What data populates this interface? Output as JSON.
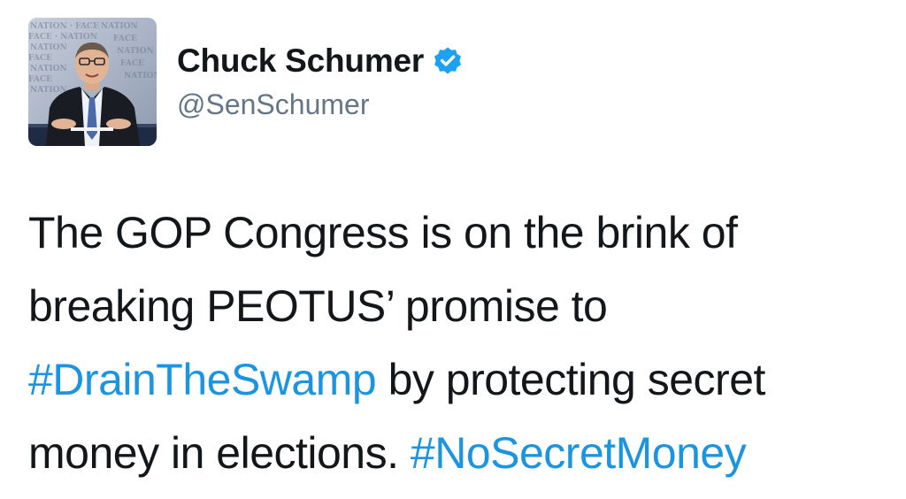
{
  "user": {
    "display_name": "Chuck Schumer",
    "handle": "@SenSchumer",
    "verified_icon": "verified-badge-icon",
    "avatar_backdrop_text": "FACE the NATION"
  },
  "tweet": {
    "line1": "The GOP Congress is on the brink of",
    "line2": "breaking PEOTUS’ promise to",
    "line3_hashtag": "#DrainTheSwamp",
    "line3_rest": " by protecting secret",
    "line4_text": "money in elections. ",
    "line4_hashtag": "#NoSecretMoney"
  },
  "colors": {
    "text": "#14171a",
    "handle": "#657786",
    "hashtag": "#1b95e0",
    "verified": "#1da1f2"
  }
}
